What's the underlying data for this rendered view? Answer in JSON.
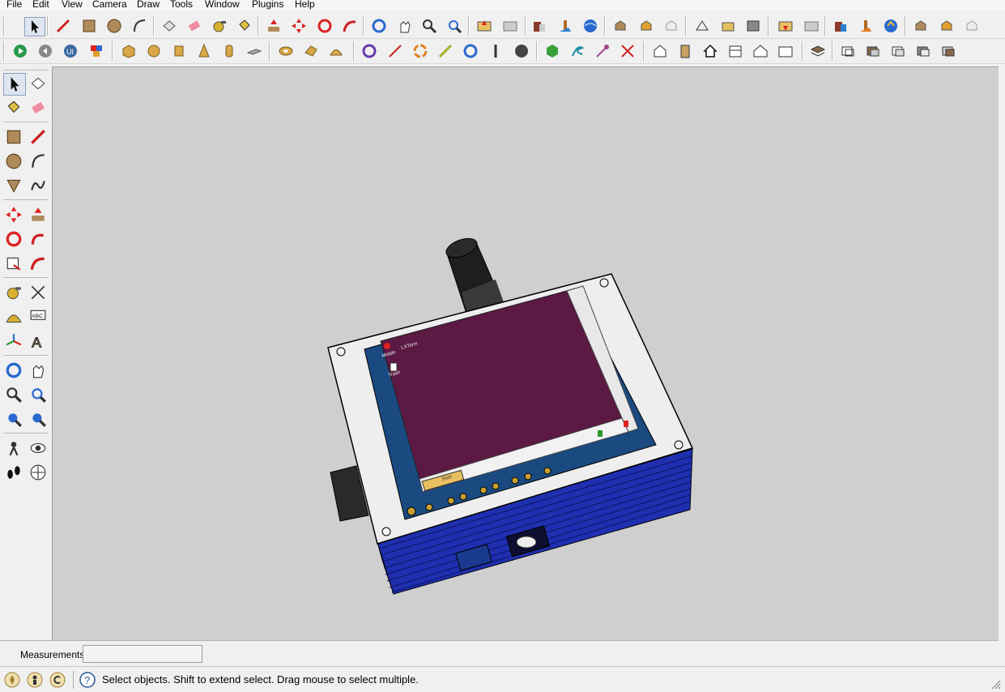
{
  "menu": [
    "File",
    "Edit",
    "View",
    "Camera",
    "Draw",
    "Tools",
    "Window",
    "Plugins",
    "Help"
  ],
  "toolbar_row1": [
    "select-icon",
    "pencil-icon",
    "rectangle-icon",
    "circle-icon",
    "arc-icon",
    "component-icon",
    "eraser-icon",
    "tape-measure-icon",
    "paint-bucket-icon",
    "push-pull-icon",
    "move-icon",
    "rotate-icon",
    "follow-me-icon",
    "orbit-icon",
    "pan-icon",
    "zoom-icon",
    "zoom-extents-icon",
    "add-location-icon",
    "toggle-terrain-icon",
    "photo-textures-icon",
    "preview-google-earth-icon",
    "get-models-icon",
    "share-model-icon",
    "share-component-icon",
    "sandbox-from-contours-icon",
    "sandbox-from-scratch-icon",
    "smoove-icon",
    "stamp-icon",
    "drape-icon",
    "add-detail-icon",
    "flip-edge-icon",
    "upload-icon",
    "download-icon",
    "share-icon"
  ],
  "toolbar_row2": [
    "play-icon",
    "rewind-icon",
    "ui-icon",
    "plugin-cubes-icon",
    "box-icon",
    "sphere-icon",
    "cylinder-icon",
    "cone-icon",
    "tube-icon",
    "plate-icon",
    "torus-icon",
    "prism-icon",
    "dome-icon",
    "rotate-ccw-icon",
    "line-red-icon",
    "arc-orange-icon",
    "line-yellow-icon",
    "rotate-blue-icon",
    "pen-icon",
    "circle-dark-icon",
    "green-hex-icon",
    "spring-icon",
    "pin-icon",
    "cross-icon",
    "house-icon",
    "door-icon",
    "home-icon",
    "window-icon",
    "roof-icon",
    "wall-icon",
    "layers-icon",
    "section-1-icon",
    "section-2-icon",
    "section-3-icon",
    "section-4-icon",
    "section-5-icon"
  ],
  "left_tools": [
    "select-icon",
    "component-icon",
    "paint-bucket-icon",
    "eraser-icon",
    "rectangle-icon",
    "line-icon",
    "circle-icon",
    "arc-icon",
    "polygon-icon",
    "freehand-icon",
    "move-icon",
    "push-pull-icon",
    "rotate-icon",
    "follow-me-icon",
    "scale-icon",
    "offset-icon",
    "tape-measure-icon",
    "dimension-icon",
    "protractor-icon",
    "text-icon",
    "axes-icon",
    "3d-text-icon",
    "orbit-icon",
    "pan-icon",
    "zoom-icon",
    "zoom-window-icon",
    "previous-icon",
    "next-icon",
    "position-camera-icon",
    "look-around-icon",
    "walk-icon",
    "section-plane-icon"
  ],
  "measurements_label": "Measurements",
  "measurements_value": "",
  "status_message": "Select objects. Shift to extend select. Drag mouse to select multiple.",
  "screen_labels": {
    "desktop_a": "Mobile",
    "desktop_b": "LXTerm",
    "desktop_c": "Trash",
    "dock_button": "Start"
  },
  "colors": {
    "screen": "#5c1944",
    "box_blue": "#1f2fb0",
    "lid": "#eeeeee",
    "viewport": "#cfcfcf"
  }
}
